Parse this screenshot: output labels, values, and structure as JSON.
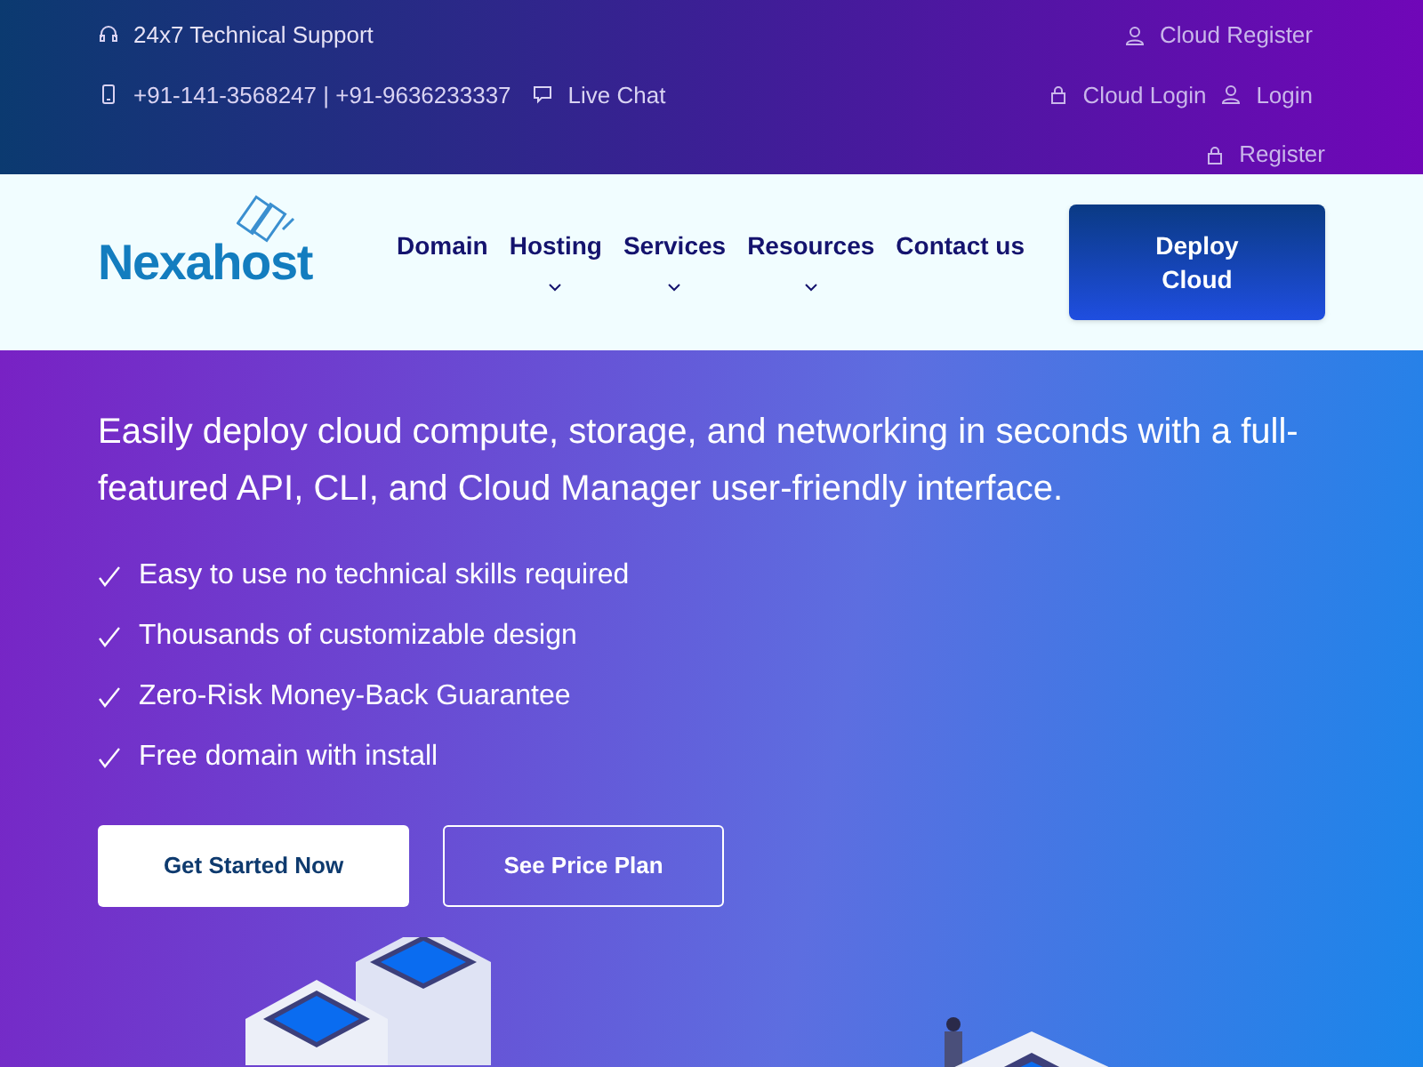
{
  "topbar": {
    "support": "24x7 Technical Support",
    "phones": "+91-141-3568247 | +91-9636233337",
    "live_chat": "Live Chat",
    "cloud_register": "Cloud Register",
    "cloud_login": "Cloud Login",
    "login": "Login",
    "register": "Register"
  },
  "navbar": {
    "logo": "Nexahost",
    "items": [
      {
        "label": "Domain",
        "dropdown": false
      },
      {
        "label": "Hosting",
        "dropdown": true
      },
      {
        "label": "Services",
        "dropdown": true
      },
      {
        "label": "Resources",
        "dropdown": true
      },
      {
        "label": "Contact us",
        "dropdown": false
      }
    ],
    "cta": "Deploy Cloud"
  },
  "hero": {
    "subtitle": "Easily deploy cloud compute, storage, and networking in seconds with a full-featured API, CLI, and Cloud Manager user-friendly interface.",
    "features": [
      "Easy to use no technical skills required",
      "Thousands of customizable design",
      "Zero-Risk Money-Back Guarantee",
      "Free domain with install"
    ],
    "primary_button": "Get Started Now",
    "secondary_button": "See Price Plan"
  }
}
